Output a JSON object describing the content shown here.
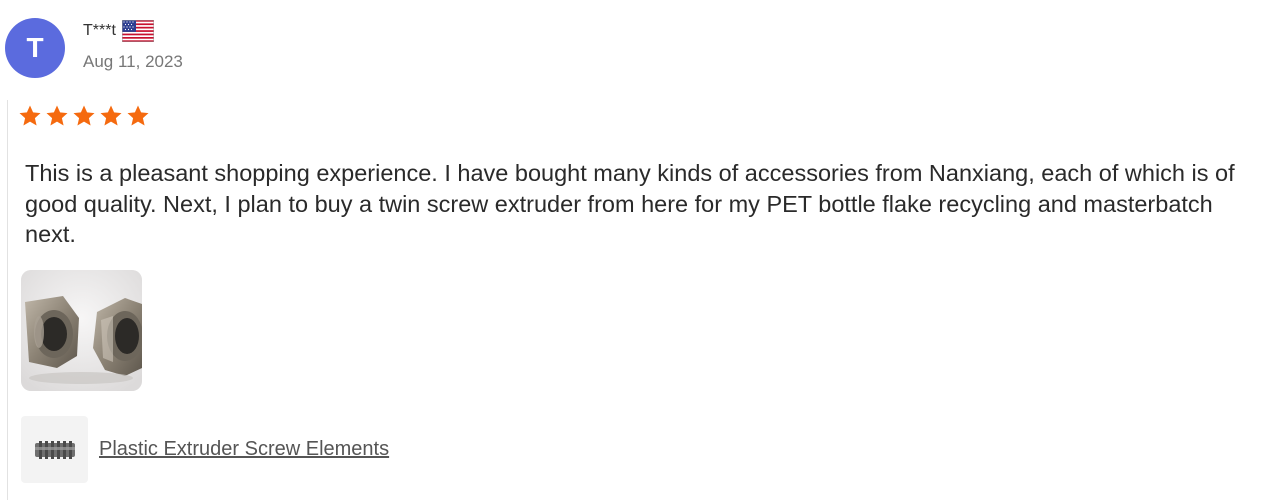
{
  "reviewer": {
    "avatar_letter": "T",
    "avatar_color": "#5b6bde",
    "name": "T***t",
    "country_flag": "us-flag-icon",
    "date": "Aug 11, 2023"
  },
  "rating": {
    "value": 5,
    "max": 5,
    "star_color": "#f56a0f"
  },
  "review": {
    "text": "This is a pleasant shopping experience. I have bought many kinds of accessories from Nanxiang, each of which is of good quality. Next, I plan to buy a twin screw extruder from here for my PET bottle flake recycling and masterbatch next."
  },
  "photos": [
    "extruder-screw-elements-photo"
  ],
  "product": {
    "thumb_icon": "screw-element-thumbnail",
    "link_text": "Plastic Extruder Screw Elements"
  }
}
